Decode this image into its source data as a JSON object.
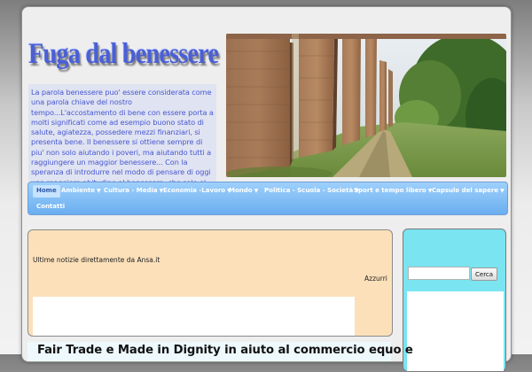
{
  "site": {
    "title": "Fuga dal benessere",
    "description": "La parola benessere puo' essere considerata come una parola chiave del nostro tempo...L'accostamento di bene con essere porta a molti significati come ad esempio buono stato di salute, agiatezza, possedere mezzi finanziari, si presenta bene. Il benessere si ottiene sempre di piu' non solo aiutando i poveri, ma aiutando tutti a raggiungere un maggior benessere... Con la speranza di introdurre nel modo di pensare di oggi una maggiore abitudine al benessere, che solo e' possibile in quanto comune."
  },
  "nav": {
    "items": [
      {
        "label": "Home",
        "active": true,
        "dropdown": false
      },
      {
        "label": "Ambiente",
        "active": false,
        "dropdown": true
      },
      {
        "label": "Cultura - Media",
        "active": false,
        "dropdown": true
      },
      {
        "label": "Economia -Lavoro",
        "active": false,
        "dropdown": true
      },
      {
        "label": "Mondo",
        "active": false,
        "dropdown": true
      },
      {
        "label": "Politica - Scuola - Società",
        "active": false,
        "dropdown": true
      },
      {
        "label": "Sport e tempo libero",
        "active": false,
        "dropdown": true
      },
      {
        "label": "Capsule del sapere",
        "active": false,
        "dropdown": true
      },
      {
        "label": "Contatti",
        "active": false,
        "dropdown": false
      }
    ]
  },
  "feed": {
    "title": "Ultime notizie direttamente da Ansa.it",
    "link": "Azzurri"
  },
  "search": {
    "value": "",
    "placeholder": "",
    "button": "Cerca"
  },
  "post": {
    "title": "Fair Trade e Made in Dignity in aiuto al commercio equo e"
  },
  "colors": {
    "title_blue": "#4a5fd6",
    "nav_blue": "#6aaef0",
    "main_box": "#fbe0b9",
    "sidebar": "#7ae4f0"
  }
}
